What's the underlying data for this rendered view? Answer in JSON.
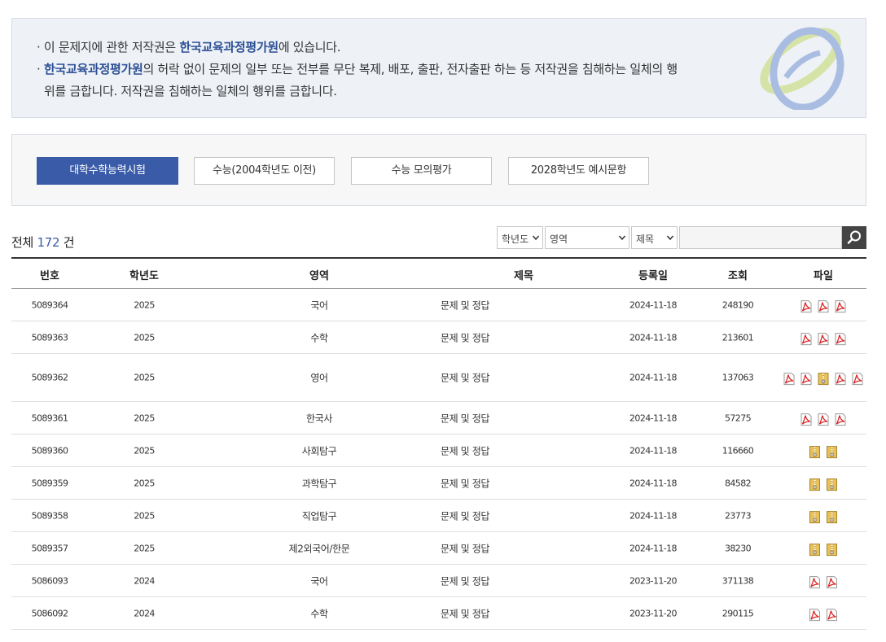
{
  "notice": {
    "line1_pre": "· 이 문제지에 관한 저작권은 ",
    "line1_em": "한국교육과정평가원",
    "line1_post": "에 있습니다.",
    "line2_pre": "· ",
    "line2_em": "한국교육과정평가원",
    "line2_post": "의 허락 없이 문제의 일부 또는 전부를 무단 복제, 배포, 출판, 전자출판 하는 등 저작권을 침해하는 일체의 행",
    "line3": "위를 금합니다. 저작권을 침해하는 일체의 행위를 금합니다."
  },
  "tabs": [
    {
      "label": "대학수학능력시험",
      "active": true
    },
    {
      "label": "수능(2004학년도 이전)",
      "active": false
    },
    {
      "label": "수능 모의평가",
      "active": false
    },
    {
      "label": "2028학년도 예시문항",
      "active": false
    }
  ],
  "total": {
    "prefix": "전체",
    "count": "172",
    "suffix": "건"
  },
  "filters": {
    "year": "학년도",
    "area": "영역",
    "title": "제목",
    "search_value": ""
  },
  "table": {
    "headers": [
      "번호",
      "학년도",
      "영역",
      "제목",
      "등록일",
      "조회",
      "파일"
    ],
    "rows": [
      {
        "no": "5089364",
        "year": "2025",
        "area": "국어",
        "title": "문제 및 정답",
        "date": "2024-11-18",
        "views": "248190",
        "files": [
          "pdf",
          "pdf",
          "pdf"
        ]
      },
      {
        "no": "5089363",
        "year": "2025",
        "area": "수학",
        "title": "문제 및 정답",
        "date": "2024-11-18",
        "views": "213601",
        "files": [
          "pdf",
          "pdf",
          "pdf"
        ]
      },
      {
        "no": "5089362",
        "year": "2025",
        "area": "영어",
        "title": "문제 및 정답",
        "date": "2024-11-18",
        "views": "137063",
        "files": [
          "pdf",
          "pdf",
          "zip",
          "pdf",
          "pdf"
        ]
      },
      {
        "no": "5089361",
        "year": "2025",
        "area": "한국사",
        "title": "문제 및 정답",
        "date": "2024-11-18",
        "views": "57275",
        "files": [
          "pdf",
          "pdf",
          "pdf"
        ]
      },
      {
        "no": "5089360",
        "year": "2025",
        "area": "사회탐구",
        "title": "문제 및 정답",
        "date": "2024-11-18",
        "views": "116660",
        "files": [
          "zip",
          "zip"
        ]
      },
      {
        "no": "5089359",
        "year": "2025",
        "area": "과학탐구",
        "title": "문제 및 정답",
        "date": "2024-11-18",
        "views": "84582",
        "files": [
          "zip",
          "zip"
        ]
      },
      {
        "no": "5089358",
        "year": "2025",
        "area": "직업탐구",
        "title": "문제 및 정답",
        "date": "2024-11-18",
        "views": "23773",
        "files": [
          "zip",
          "zip"
        ]
      },
      {
        "no": "5089357",
        "year": "2025",
        "area": "제2외국어/한문",
        "title": "문제 및 정답",
        "date": "2024-11-18",
        "views": "38230",
        "files": [
          "zip",
          "zip"
        ]
      },
      {
        "no": "5086093",
        "year": "2024",
        "area": "국어",
        "title": "문제 및 정답",
        "date": "2023-11-20",
        "views": "371138",
        "files": [
          "pdf",
          "pdf"
        ]
      },
      {
        "no": "5086092",
        "year": "2024",
        "area": "수학",
        "title": "문제 및 정답",
        "date": "2023-11-20",
        "views": "290115",
        "files": [
          "pdf",
          "pdf"
        ]
      }
    ]
  },
  "icons": {
    "pdf": "pdf-file-icon",
    "zip": "zip-file-icon",
    "search": "search-icon",
    "select": "chevron-down-icon"
  },
  "colors": {
    "accent": "#3a5ca8",
    "notice_bg": "#eef2f7",
    "search_btn": "#444444"
  }
}
